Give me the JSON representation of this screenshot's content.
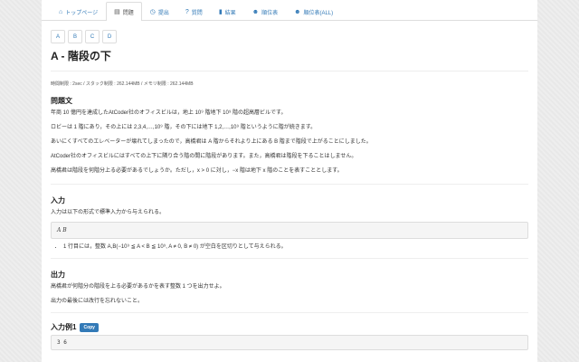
{
  "nav": {
    "items": [
      {
        "icon": "⌂",
        "label": "トップページ"
      },
      {
        "icon": "▤",
        "label": "問題"
      },
      {
        "icon": "◷",
        "label": "提出"
      },
      {
        "icon": "?",
        "label": "質問"
      },
      {
        "icon": "▮",
        "label": "結果"
      },
      {
        "icon": "☻",
        "label": "順位表"
      },
      {
        "icon": "☻",
        "label": "順位表(ALL)"
      }
    ]
  },
  "task_tabs": [
    "A",
    "B",
    "C",
    "D"
  ],
  "title": "A - 階段の下",
  "limits": "時間制限 : 2sec / スタック制限 : 262.144MB / メモリ制限 : 262.144MB",
  "problem": {
    "heading": "問題文",
    "p1": "年商 10 億円を達成したAtCoder社のオフィスビルは，地上 10⁹ 階地下 10⁹ 階の超高層ビルです。",
    "p2": "ロビーは 1 階にあり，その上には 2,3,4,…,10⁹ 階，その下には地下 1,2,…,10⁹ 階というように階が続きます。",
    "p3": "あいにくすべてのエレベーターが壊れてしまったので，高橋君は A 階からそれより上にある B 階まで階段で上がることにしました。",
    "p4": "AtCoder社のオフィスビルにはすべての上下に隣り合う階の間に階段があります。また，高橋君は階段を下ることはしません。",
    "p5": "高橋君は階段を何階分上る必要があるでしょうか。ただし，x > 0 に対し，−x 階は地下 x 階のことを表すこととします。"
  },
  "input": {
    "heading": "入力",
    "intro": "入力は以下の形式で標準入力から与えられる。",
    "format": "A  B",
    "constraint": "1 行目には，整数 A,B(−10⁹ ≦ A < B ≦ 10⁹, A ≠ 0, B ≠ 0) が空白を区切りとして与えられる。"
  },
  "output": {
    "heading": "出力",
    "p1": "高橋君が何階分の階段を上る必要があるかを表す整数 1 つを出力せよ。",
    "p2": "出力の最後には改行を忘れないこと。"
  },
  "sample": {
    "heading": "入力例1",
    "copy_label": "Copy",
    "value": "3 6"
  }
}
